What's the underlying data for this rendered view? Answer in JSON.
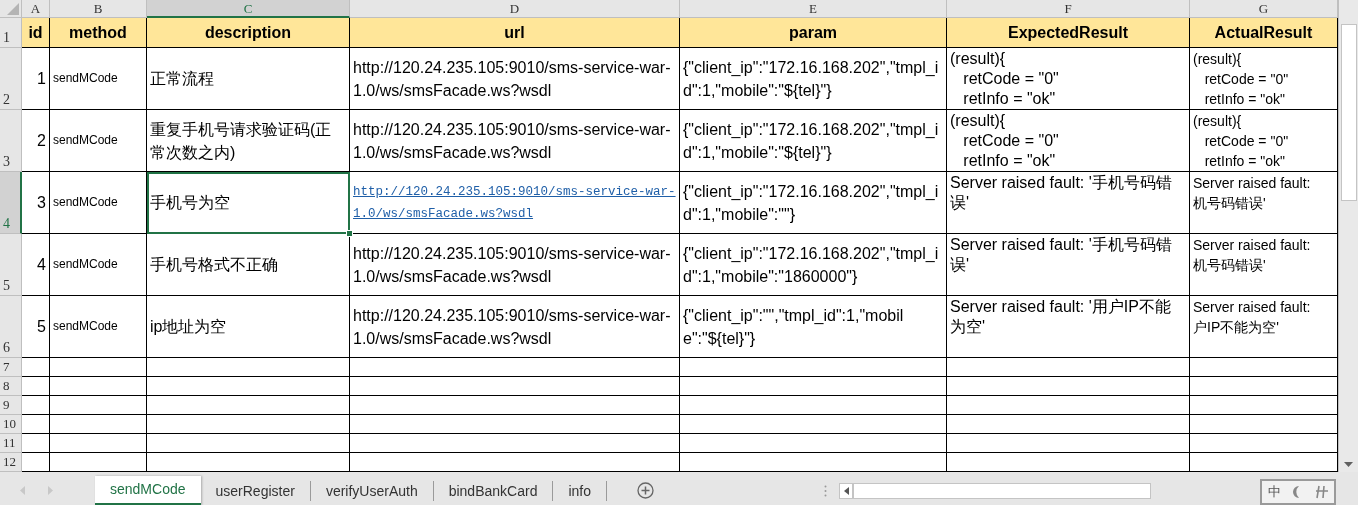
{
  "columns": [
    {
      "letter": "A",
      "selected": false
    },
    {
      "letter": "B",
      "selected": false
    },
    {
      "letter": "C",
      "selected": true
    },
    {
      "letter": "D",
      "selected": false
    },
    {
      "letter": "E",
      "selected": false
    },
    {
      "letter": "F",
      "selected": false
    },
    {
      "letter": "G",
      "selected": false
    }
  ],
  "header_row": {
    "number": "1",
    "cells": [
      "id",
      "method",
      "description",
      "url",
      "param",
      "ExpectedResult",
      "ActualResult"
    ]
  },
  "rows": [
    {
      "number": "2",
      "selected": false,
      "id": "1",
      "method": "sendMCode",
      "description": "正常流程",
      "url": "http://120.24.235.105:9010/sms-service-war-1.0/ws/smsFacade.ws?wsdl",
      "url_link": false,
      "param": "{\"client_ip\":\"172.16.168.202\",\"tmpl_id\":1,\"mobile\":\"${tel}\"}",
      "expected": "(result){\n   retCode = \"0\"\n   retInfo = \"ok\"",
      "actual": "(result){\n   retCode = \"0\"\n   retInfo = \"ok\""
    },
    {
      "number": "3",
      "selected": false,
      "id": "2",
      "method": "sendMCode",
      "description": "重复手机号请求验证码(正常次数之内)",
      "url": "http://120.24.235.105:9010/sms-service-war-1.0/ws/smsFacade.ws?wsdl",
      "url_link": false,
      "param": "{\"client_ip\":\"172.16.168.202\",\"tmpl_id\":1,\"mobile\":\"${tel}\"}",
      "expected": "(result){\n   retCode = \"0\"\n   retInfo = \"ok\"",
      "actual": "(result){\n   retCode = \"0\"\n   retInfo = \"ok\""
    },
    {
      "number": "4",
      "selected": true,
      "id": "3",
      "method": "sendMCode",
      "description": "手机号为空",
      "url": "http://120.24.235.105:9010/sms-service-war-1.0/ws/smsFacade.ws?wsdl",
      "url_link": true,
      "param": "{\"client_ip\":\"172.16.168.202\",\"tmpl_id\":1,\"mobile\":\"\"}",
      "expected": "Server raised fault: '手机号码错误'",
      "actual": "Server raised fault:\n机号码错误'"
    },
    {
      "number": "5",
      "selected": false,
      "id": "4",
      "method": "sendMCode",
      "description": "手机号格式不正确",
      "url": "http://120.24.235.105:9010/sms-service-war-1.0/ws/smsFacade.ws?wsdl",
      "url_link": false,
      "param": "{\"client_ip\":\"172.16.168.202\",\"tmpl_id\":1,\"mobile\":\"1860000\"}",
      "expected": "Server raised fault: '手机号码错误'",
      "actual": "Server raised fault:\n机号码错误'"
    },
    {
      "number": "6",
      "selected": false,
      "id": "5",
      "method": "sendMCode",
      "description": "ip地址为空",
      "url": "http://120.24.235.105:9010/sms-service-war-1.0/ws/smsFacade.ws?wsdl",
      "url_link": false,
      "param": "{\"client_ip\":\"\",\"tmpl_id\":1,\"mobile\":\"${tel}\"}",
      "expected": "Server raised fault: '用户IP不能为空'",
      "actual": "Server raised fault:\n户IP不能为空'"
    }
  ],
  "empty_rows": [
    "7",
    "8",
    "9",
    "10",
    "11",
    "12"
  ],
  "sheet_tabs": [
    {
      "label": "sendMCode",
      "selected": true
    },
    {
      "label": "userRegister",
      "selected": false
    },
    {
      "label": "verifyUserAuth",
      "selected": false
    },
    {
      "label": "bindBankCard",
      "selected": false
    },
    {
      "label": "info",
      "selected": false
    }
  ],
  "ime": {
    "mode": "中"
  }
}
